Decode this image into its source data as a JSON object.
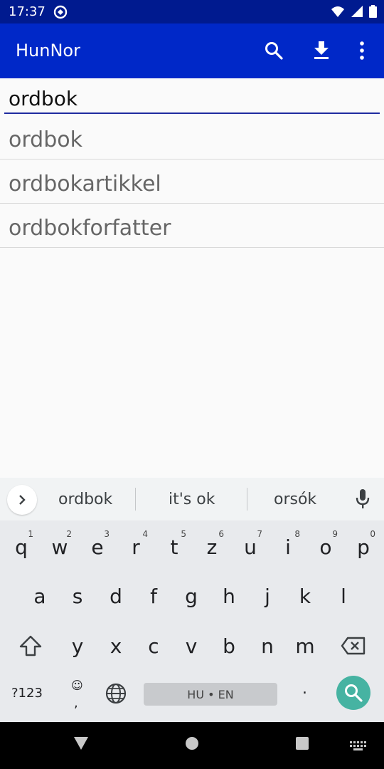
{
  "status": {
    "time": "17:37",
    "icons": [
      "sync-icon",
      "wifi-icon",
      "signal-icon",
      "battery-icon"
    ]
  },
  "app": {
    "title": "HunNor",
    "actions": [
      "search-icon",
      "download-icon",
      "more-vert-icon"
    ],
    "colors": {
      "app_bar": "#0028c8",
      "status_bar": "#001a8f",
      "accent": "#46b3a2"
    }
  },
  "search": {
    "value": "ordbok"
  },
  "suggestions": [
    "ordbok",
    "ordbokartikkel",
    "ordbokforfatter"
  ],
  "keyboard": {
    "strip": {
      "words": [
        "ordbok",
        "it's ok",
        "orsók"
      ]
    },
    "row1": [
      {
        "key": "q",
        "hint": "1"
      },
      {
        "key": "w",
        "hint": "2"
      },
      {
        "key": "e",
        "hint": "3"
      },
      {
        "key": "r",
        "hint": "4"
      },
      {
        "key": "t",
        "hint": "5"
      },
      {
        "key": "z",
        "hint": "6"
      },
      {
        "key": "u",
        "hint": "7"
      },
      {
        "key": "i",
        "hint": "8"
      },
      {
        "key": "o",
        "hint": "9"
      },
      {
        "key": "p",
        "hint": "0"
      }
    ],
    "row2": [
      "a",
      "s",
      "d",
      "f",
      "g",
      "h",
      "j",
      "k",
      "l"
    ],
    "row3": [
      "y",
      "x",
      "c",
      "v",
      "b",
      "n",
      "m"
    ],
    "bottom": {
      "sym": "?123",
      "emoji": "☺",
      "comma": ",",
      "space": "HU • EN",
      "period": "."
    }
  }
}
